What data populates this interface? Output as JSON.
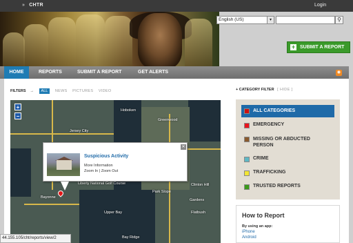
{
  "topbar": {
    "brand": "CHTR",
    "login": "Login"
  },
  "header": {
    "language": "English (US)",
    "search_placeholder": "",
    "submit_report": "SUBMIT A REPORT"
  },
  "nav": {
    "items": [
      "HOME",
      "REPORTS",
      "SUBMIT A REPORT",
      "GET ALERTS"
    ]
  },
  "filters": {
    "label": "FILTERS",
    "options": [
      "ALL",
      "NEWS",
      "PICTURES",
      "VIDEO"
    ]
  },
  "map": {
    "labels": [
      "Hoboken",
      "Jersey City",
      "Greenwood",
      "Bayonne",
      "Liberty National Golf Course",
      "Clinton Hill",
      "Park Slope",
      "Gardens",
      "Flatbush",
      "Upper Bay",
      "Bay Ridge"
    ]
  },
  "popup": {
    "title": "Suspicious Activity",
    "more": "More Information",
    "zoom_in": "Zoom In",
    "separator": "|",
    "zoom_out": "Zoom Out"
  },
  "category_filter": {
    "label": "+ CATEGORY FILTER",
    "hide": "[ HIDE ]"
  },
  "categories": [
    {
      "label": "ALL CATEGORIES",
      "color": "#cc1111"
    },
    {
      "label": "EMERGENCY",
      "color": "#e8161e"
    },
    {
      "label": "MISSING OR ABDUCTED PERSON",
      "color": "#8a5a2e"
    },
    {
      "label": "CRIME",
      "color": "#5fb8c4"
    },
    {
      "label": "TRAFFICKING",
      "color": "#f2e534"
    },
    {
      "label": "TRUSTED REPORTS",
      "color": "#3c9a1c"
    }
  ],
  "howto": {
    "title": "How to Report",
    "subtitle": "By using an app:",
    "links": [
      "iPhone",
      "Android"
    ]
  },
  "status_url": "44.155.105/cht/reports/view/2"
}
